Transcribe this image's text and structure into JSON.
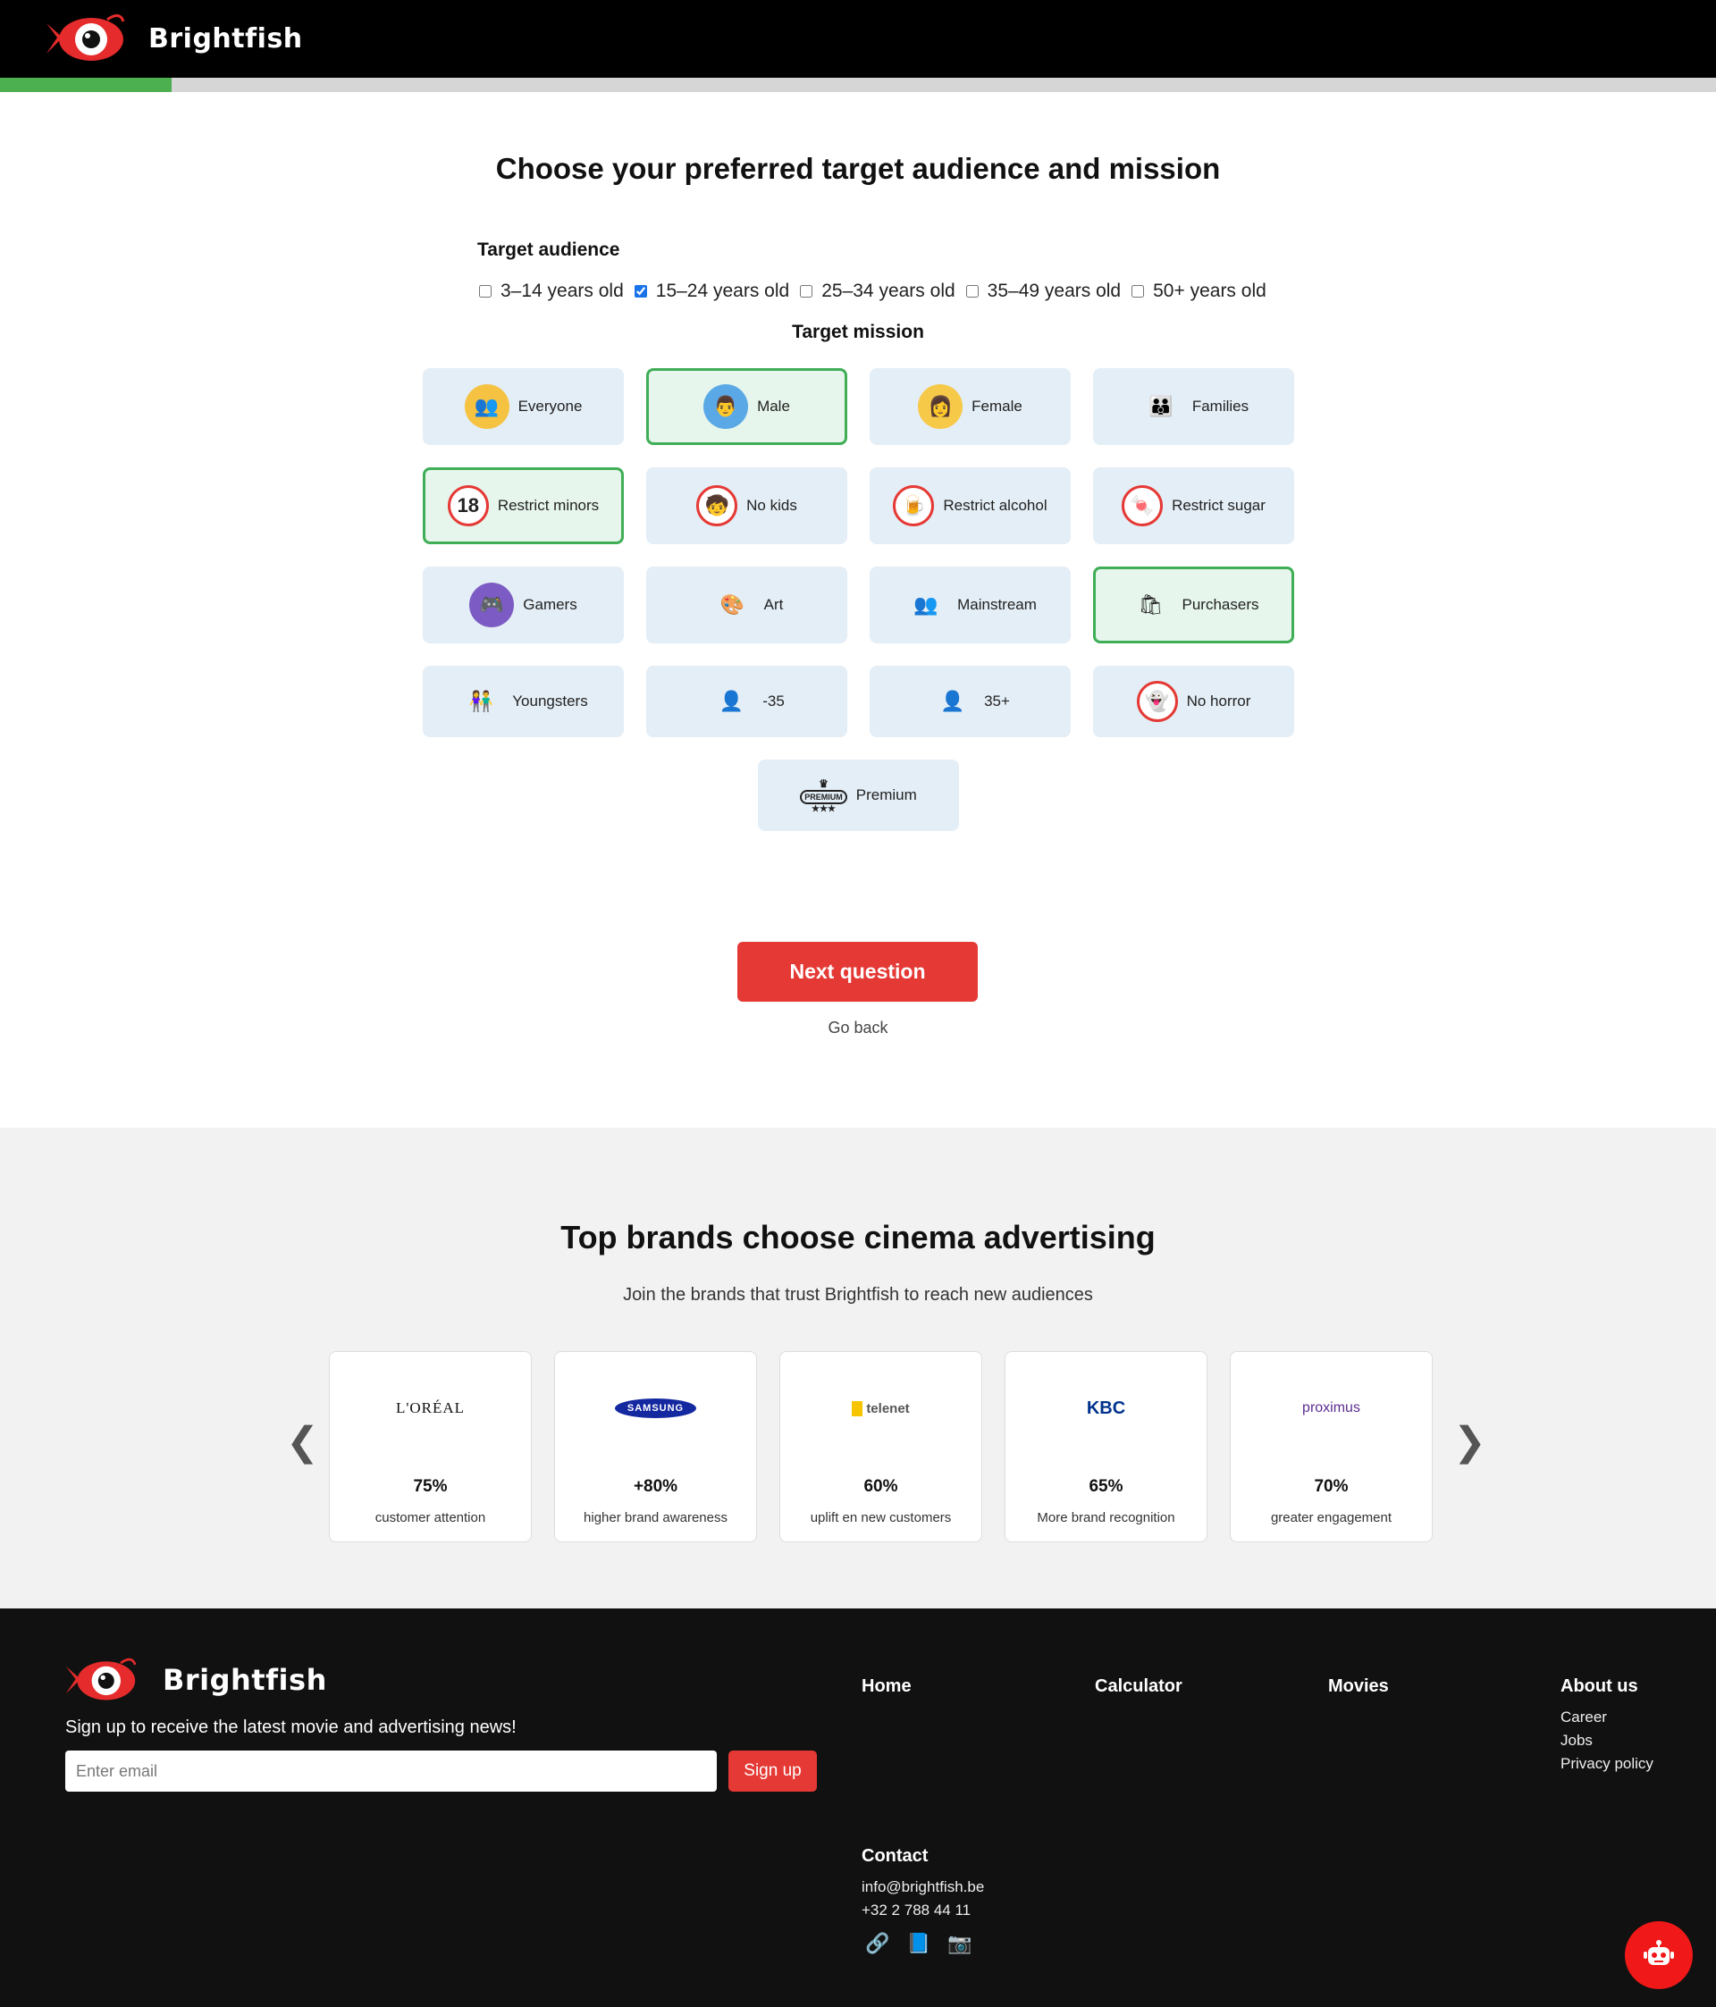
{
  "brand": {
    "name": "Brightfish"
  },
  "progress": {
    "fraction": 0.1
  },
  "question": {
    "title": "Choose your preferred target audience and mission",
    "target_audience_label": "Target audience",
    "target_mission_label": "Target mission",
    "ages": [
      {
        "label": "3–14 years old",
        "checked": false
      },
      {
        "label": "15–24 years old",
        "checked": true
      },
      {
        "label": "25–34 years old",
        "checked": false
      },
      {
        "label": "35–49 years old",
        "checked": false
      },
      {
        "label": "50+ years old",
        "checked": false
      }
    ],
    "missions": [
      {
        "label": "Everyone",
        "icon": "crowd-icon",
        "glyph": "👥",
        "bg": "#f5c242",
        "selected": false
      },
      {
        "label": "Male",
        "icon": "male-avatar-icon",
        "glyph": "👨",
        "bg": "#5aa9e6",
        "selected": true
      },
      {
        "label": "Female",
        "icon": "female-avatar-icon",
        "glyph": "👩",
        "bg": "#f7c948",
        "selected": false
      },
      {
        "label": "Families",
        "icon": "family-icon",
        "glyph": "👪",
        "bg": "#e4eef6",
        "selected": false
      },
      {
        "label": "Restrict minors",
        "icon": "no-under-18-icon",
        "glyph": "18",
        "bg": "#fff",
        "selected": true
      },
      {
        "label": "No kids",
        "icon": "no-kids-icon",
        "glyph": "🧒",
        "bg": "#fff",
        "selected": false
      },
      {
        "label": "Restrict alcohol",
        "icon": "no-alcohol-icon",
        "glyph": "🍺",
        "bg": "#fff",
        "selected": false
      },
      {
        "label": "Restrict sugar",
        "icon": "no-sugar-icon",
        "glyph": "🍬",
        "bg": "#fff",
        "selected": false
      },
      {
        "label": "Gamers",
        "icon": "gamer-icon",
        "glyph": "🎮",
        "bg": "#7c5cc4",
        "selected": false
      },
      {
        "label": "Art",
        "icon": "art-palette-icon",
        "glyph": "🎨",
        "bg": "#e4eef6",
        "selected": false
      },
      {
        "label": "Mainstream",
        "icon": "mainstream-icon",
        "glyph": "👥",
        "bg": "#e4eef6",
        "selected": false
      },
      {
        "label": "Purchasers",
        "icon": "shopper-icon",
        "glyph": "🛍",
        "bg": "#e6f6ec",
        "selected": true
      },
      {
        "label": "Youngsters",
        "icon": "youngsters-icon",
        "glyph": "👫",
        "bg": "#e4eef6",
        "selected": false
      },
      {
        "label": "-35",
        "icon": "under-35-icon",
        "glyph": "👤",
        "bg": "#e4eef6",
        "selected": false
      },
      {
        "label": "35+",
        "icon": "over-35-icon",
        "glyph": "👤",
        "bg": "#e4eef6",
        "selected": false
      },
      {
        "label": "No horror",
        "icon": "no-horror-icon",
        "glyph": "👻",
        "bg": "#fff",
        "selected": false
      }
    ],
    "premium": {
      "label": "Premium",
      "icon": "premium-badge-icon",
      "glyph": "PREMIUM",
      "selected": false
    },
    "next_label": "Next question",
    "back_label": "Go back"
  },
  "brands_section": {
    "title": "Top brands choose cinema advertising",
    "subtitle": "Join the brands that trust Brightfish to reach new audiences",
    "prev_icon": "❮",
    "next_icon": "❯",
    "cards": [
      {
        "logo": "L'ORÉAL",
        "stat": "75%",
        "desc": "customer attention"
      },
      {
        "logo": "SAMSUNG",
        "stat": "+80%",
        "desc": "higher brand awareness"
      },
      {
        "logo": "telenet",
        "stat": "60%",
        "desc": "uplift en new customers"
      },
      {
        "logo": "KBC",
        "stat": "65%",
        "desc": "More brand recognition"
      },
      {
        "logo": "proximus",
        "stat": "70%",
        "desc": "greater engagement"
      }
    ]
  },
  "footer": {
    "signup_text": "Sign up to receive the latest movie and advertising news!",
    "email_placeholder": "Enter email",
    "signup_button": "Sign up",
    "nav": {
      "home": "Home",
      "calculator": "Calculator",
      "movies": "Movies",
      "about": "About us"
    },
    "about_links": [
      "Career",
      "Jobs",
      "Privacy policy"
    ],
    "contact_title": "Contact",
    "email": "info@brightfish.be",
    "phone": "+32 2 788 44 11",
    "social": [
      {
        "icon": "link-icon",
        "glyph": "🔗"
      },
      {
        "icon": "book-icon",
        "glyph": "📘"
      },
      {
        "icon": "camera-icon",
        "glyph": "📷"
      }
    ]
  }
}
